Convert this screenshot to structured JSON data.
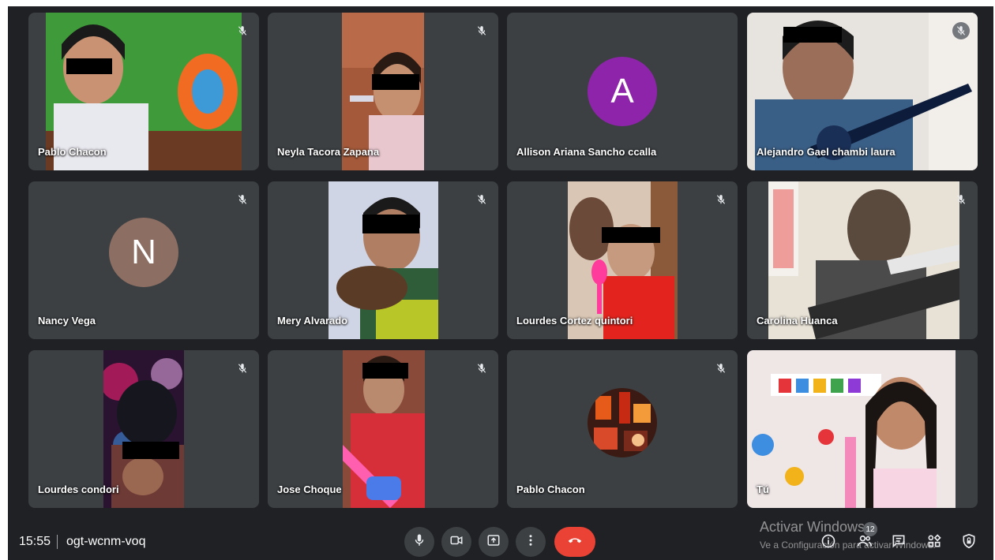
{
  "participants": [
    {
      "name": "Pablo Chacon"
    },
    {
      "name": "Neyla Tacora Zapana"
    },
    {
      "name": "Allison Ariana Sancho ccalla",
      "initial": "A",
      "color": "#8e24aa"
    },
    {
      "name": "Alejandro Gael chambi laura"
    },
    {
      "name": "Nancy Vega",
      "initial": "N",
      "color": "#8d6e63"
    },
    {
      "name": "Mery Alvarado"
    },
    {
      "name": "Lourdes Cortez quintori"
    },
    {
      "name": "Carolina Huanca"
    },
    {
      "name": "Lourdes condori"
    },
    {
      "name": "Jose Choque"
    },
    {
      "name": "Pablo Chacon"
    },
    {
      "name": "Tú"
    }
  ],
  "meeting": {
    "time": "15:55",
    "code": "ogt-wcnm-voq"
  },
  "controls": [
    {
      "icon": "mic-icon"
    },
    {
      "icon": "camera-icon"
    },
    {
      "icon": "present-icon"
    },
    {
      "icon": "more-options-icon"
    },
    {
      "icon": "end-call-icon",
      "color": "#ea4335"
    }
  ],
  "right_controls": [
    {
      "icon": "info-icon"
    },
    {
      "icon": "people-icon",
      "count": "12"
    },
    {
      "icon": "chat-icon"
    },
    {
      "icon": "activities-icon"
    },
    {
      "icon": "host-controls-icon"
    }
  ],
  "watermark": {
    "line1": "Activar Windows",
    "line2": "Ve a Configuración para activar Windows."
  }
}
